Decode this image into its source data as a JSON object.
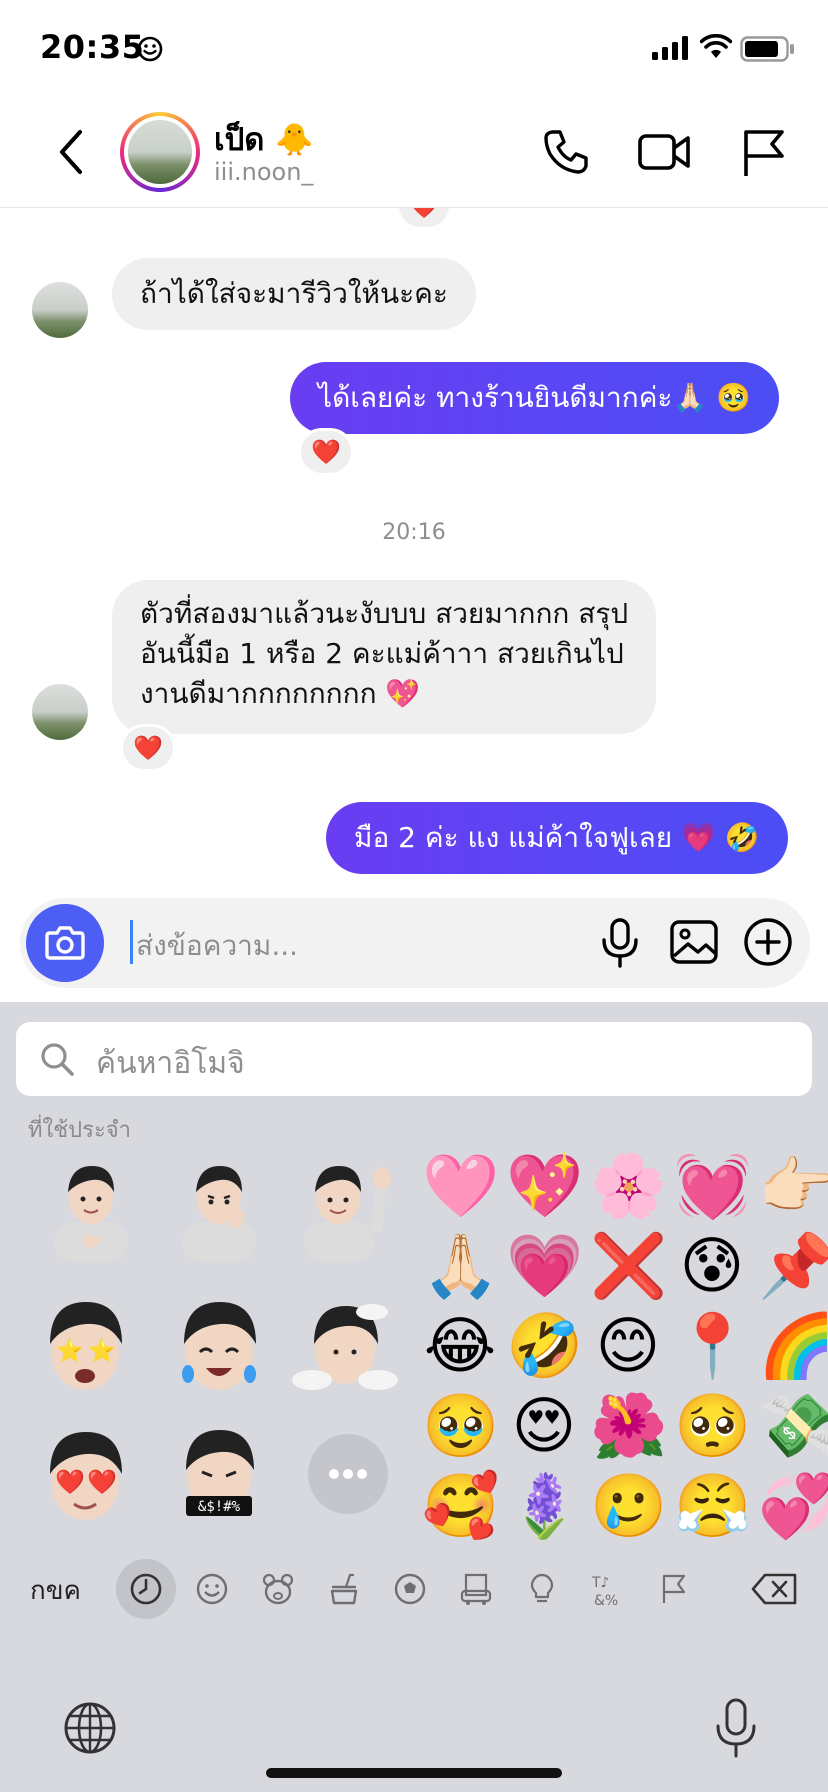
{
  "status_bar": {
    "time": "20:35",
    "focus_icon": "smile-icon",
    "signal": "cellular-signal-icon",
    "wifi": "wifi-icon",
    "battery": "battery-icon"
  },
  "header": {
    "name": "เป็ด 🐥",
    "handle": "iii.noon_",
    "actions": [
      "phone-icon",
      "video-camera-icon",
      "flag-icon"
    ]
  },
  "messages": [
    {
      "from": "them",
      "text": "ถ้าได้ใส่จะมารีวิวให้นะคะ"
    },
    {
      "from": "me",
      "text": "ได้เลยค่ะ ทางร้านยินดีมากค่ะ🙏🏻 🥹",
      "reaction": "❤️"
    },
    {
      "timestamp": "20:16"
    },
    {
      "from": "them",
      "lines": [
        "ตัวที่สองมาแล้วนะงับบบ สวยมากกก สรุป",
        "อันนี้มือ 1 หรือ 2 คะแม่ค้าาา สวยเกินไป",
        "งานดีมากกกกกกกก 💖"
      ],
      "reaction": "❤️"
    },
    {
      "from": "me",
      "text": "มือ 2 ค่ะ แง แม่ค้าใจฟูเลย 💗 🤣"
    }
  ],
  "top_reaction": "❤️",
  "composer": {
    "placeholder": "ส่งข้อความ..."
  },
  "keyboard": {
    "search_placeholder": "ค้นหาอิโมจิ",
    "section_label": "ที่ใช้ประจำ",
    "layout_key": "กขค",
    "memoji_overlay": "&$!#%",
    "emoji_grid": [
      [
        "🩷",
        "💖",
        "🌸",
        "💓",
        "👉🏻"
      ],
      [
        "🙏🏻",
        "💗",
        "❌",
        "😰",
        "📌"
      ],
      [
        "😂",
        "🤣",
        "😊",
        "📍",
        "🌈"
      ],
      [
        "🥹",
        "😍",
        "🌺",
        "🥺",
        "💸"
      ],
      [
        "🥰",
        "🪻",
        "🥲",
        "😤",
        "💞"
      ]
    ],
    "categories": [
      "clock-icon",
      "smiley-icon",
      "bear-icon",
      "food-icon",
      "ball-icon",
      "building-icon",
      "bulb-icon",
      "symbols-icon",
      "flag-icon"
    ]
  },
  "colors": {
    "outgoing_bubble": "#5b40f5",
    "incoming_bubble": "#efefef",
    "keyboard_bg": "#d7d9de",
    "camera_button": "#4d5ef5"
  }
}
